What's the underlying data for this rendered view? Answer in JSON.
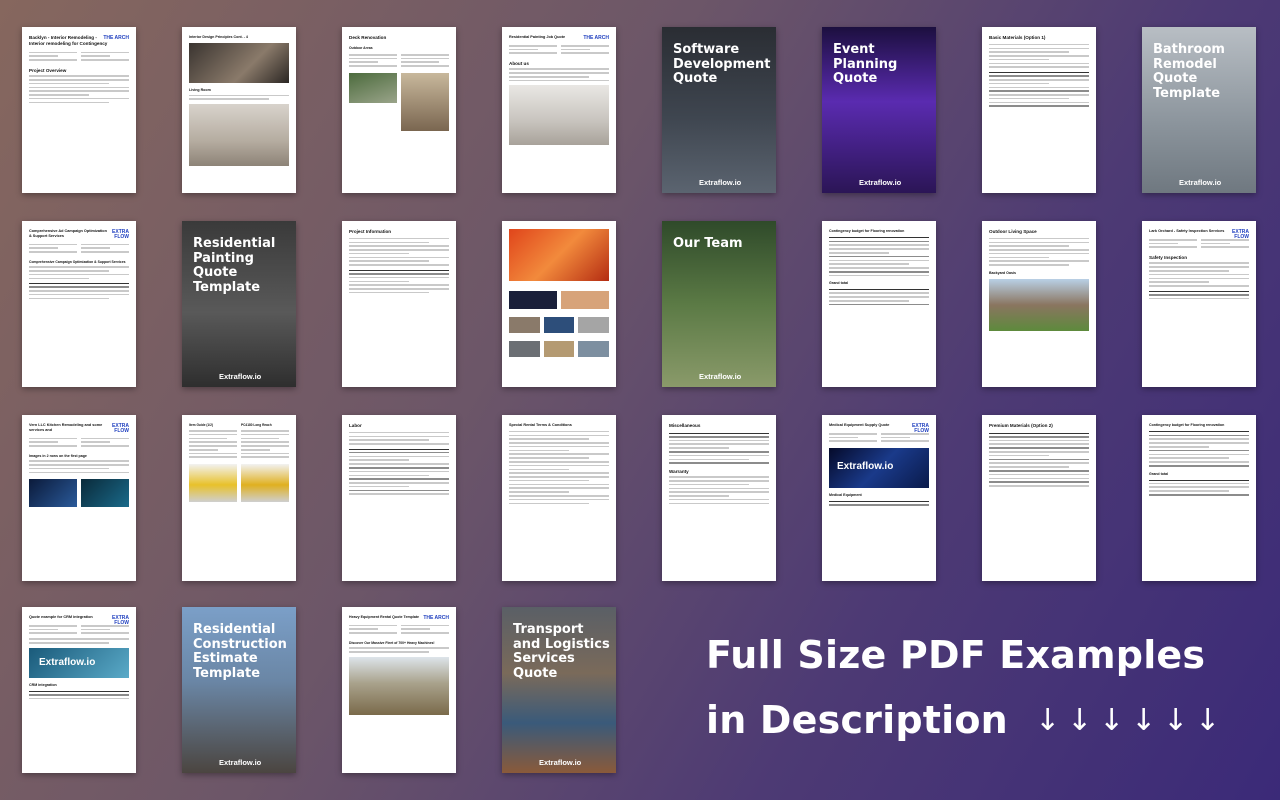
{
  "headline": {
    "line1": "Full Size PDF Examples",
    "line2": "in Description",
    "arrows": [
      "↓",
      "↓",
      "↓",
      "↓",
      "↓",
      "↓"
    ]
  },
  "brand": "Extraflow.io",
  "logos": {
    "the_arch": "THE ARCH",
    "extraflow": "EXTRA FLOW"
  },
  "covers": [
    {
      "title": "Software Development Quote",
      "bg": "#3a3f47"
    },
    {
      "title": "Event Planning Quote",
      "bg": "#3d1e7a"
    },
    {
      "title": "Bathroom Remodel Quote Template",
      "bg": "#9aa2aa"
    },
    {
      "title": "Residential Painting Quote Template",
      "bg": "#4b4b4b"
    },
    {
      "title": "Our Team",
      "bg": "#4f6b3a"
    },
    {
      "title": "Residential Construction Estimate Template",
      "bg": "#6b87a8"
    },
    {
      "title": "Transport and Logistics Services Quote",
      "bg": "#5a5f66"
    }
  ],
  "docs": [
    {
      "title": "Backlyn - Interior Remodeling - Interior remodeling for Contingency",
      "section": "Project Overview"
    },
    {
      "title": "Interior Design Principles Cont. - 4",
      "section": "Living Room"
    },
    {
      "title": "Deck Renovation",
      "section": "Outdoor Areas"
    },
    {
      "title": "Residential Painting Job Quote",
      "section": "About us"
    },
    {
      "title": "Basic Materials (Option 1)",
      "section": ""
    },
    {
      "title": "Comprehensive Ad Campaign Optimization & Support Services",
      "section": "Comprehensive Campaign Optimization & Support Services"
    },
    {
      "title": "Project Information",
      "section": ""
    },
    {
      "title": "Contingency budget for Flooring renovation",
      "section": "Grand total"
    },
    {
      "title": "Outdoor Living Space",
      "section": "Backyard Oasis"
    },
    {
      "title": "Lark Orchard - Safety Inspection Services",
      "section": "Safety Inspection"
    },
    {
      "title": "Vern LLC Kitchen Remodeling and some services and",
      "section": "Images in 2 rows on the first page"
    },
    {
      "title": "Item Guide (1/2)",
      "section": "PC4180 Long Reach"
    },
    {
      "title": "Labor",
      "section": ""
    },
    {
      "title": "Special Rental Terms & Conditions",
      "section": ""
    },
    {
      "title": "Miscellaneous",
      "section": "Warranty"
    },
    {
      "title": "Medical Equipment Supply Quote",
      "section": "Medical Equipment"
    },
    {
      "title": "Premium Materials (Option 2)",
      "section": ""
    },
    {
      "title": "Contingency budget for Flooring renovation",
      "section": "Grand total"
    },
    {
      "title": "Quote example for CRM integration",
      "section": "CRM integration"
    },
    {
      "title": "Heavy Equipment Rental Quote Template",
      "section": "Discover Our Massive Fleet of 700+ Heavy Machines!"
    }
  ]
}
